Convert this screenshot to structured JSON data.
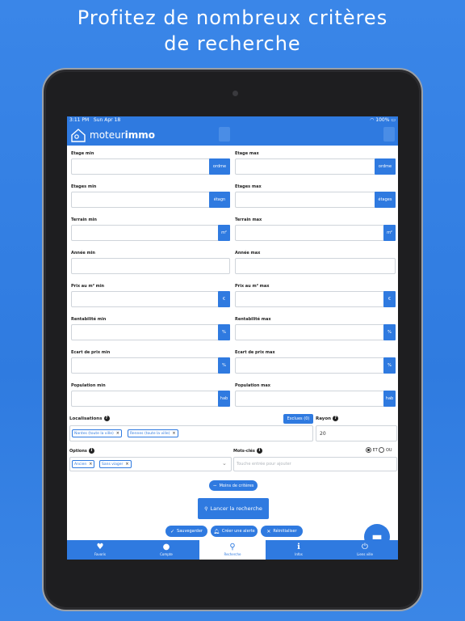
{
  "headline": {
    "line1": "Profitez de nombreux critères",
    "line2": "de recherche"
  },
  "status": {
    "time": "3:11 PM",
    "date": "Sun Apr 18",
    "battery": "100%"
  },
  "app": {
    "brand_light": "moteur",
    "brand_bold": "immo"
  },
  "fields": [
    {
      "label": "Etage min",
      "suffix": "ordme"
    },
    {
      "label": "Etage max",
      "suffix": "ordme"
    },
    {
      "label": "Etages min",
      "suffix": "étagn"
    },
    {
      "label": "Etages max",
      "suffix": "étages"
    },
    {
      "label": "Terrain min",
      "suffix": "m²"
    },
    {
      "label": "Terrain max",
      "suffix": "m²"
    },
    {
      "label": "Année min",
      "suffix": ""
    },
    {
      "label": "Année max",
      "suffix": ""
    },
    {
      "label": "Prix au m² min",
      "suffix": "€"
    },
    {
      "label": "Prix au m² max",
      "suffix": "€"
    },
    {
      "label": "Rentabilité min",
      "suffix": "%"
    },
    {
      "label": "Rentabilité max",
      "suffix": "%"
    },
    {
      "label": "Ecart de prix min",
      "suffix": "%"
    },
    {
      "label": "Ecart de prix max",
      "suffix": "%"
    },
    {
      "label": "Population min",
      "suffix": "hab"
    },
    {
      "label": "Population max",
      "suffix": "hab"
    }
  ],
  "localisations": {
    "label": "Localisations",
    "exclusions_button": "Exclues (0)",
    "chips": [
      "Nantes (toute la ville)",
      "Rennes (toute la ville)"
    ]
  },
  "rayon": {
    "label": "Rayon",
    "value": "20"
  },
  "options": {
    "label": "Options",
    "chips": [
      "Ancien",
      "Sans viager"
    ]
  },
  "mots_cles": {
    "label": "Mots-clés",
    "placeholder": "Touche entrée pour ajouter",
    "radio_et": "ET",
    "radio_ou": "OU"
  },
  "buttons": {
    "moins_criteres": "Moins de critères",
    "lancer": "Lancer la recherche",
    "sauvegarder": "Sauvegarder",
    "alerte": "Créer une alerte",
    "reinit": "Réinitialiser"
  },
  "tabs": [
    "Favoris",
    "Compte",
    "Recherche",
    "Infos",
    "Liens ville"
  ],
  "colors": {
    "primary": "#2f7ae0",
    "background": "#3a86e8"
  },
  "icons": {
    "favoris": "heart-icon",
    "compte": "user-icon",
    "recherche": "search-icon",
    "infos": "info-icon",
    "liens": "power-icon",
    "chat": "chat-icon"
  }
}
